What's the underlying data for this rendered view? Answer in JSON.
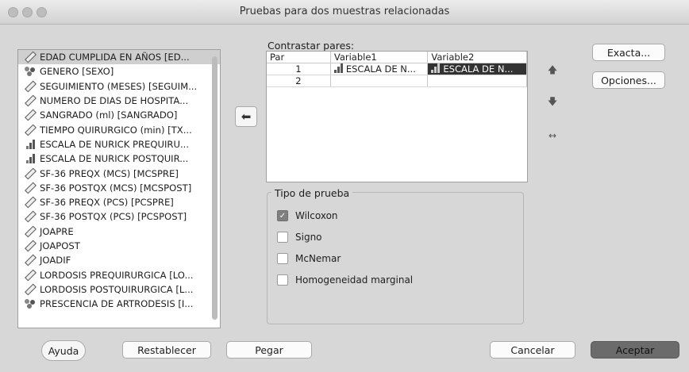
{
  "window": {
    "title": "Pruebas para dos muestras relacionadas"
  },
  "variables": [
    {
      "label": "EDAD CUMPLIDA EN AÑOS [ED...",
      "icon": "ruler-scale-icon",
      "selected": true
    },
    {
      "label": "GENERO [SEXO]",
      "icon": "nominal-icon",
      "selected": false
    },
    {
      "label": "SEGUIMIENTO (MESES) [SEGUIM...",
      "icon": "ruler-scale-icon",
      "selected": false
    },
    {
      "label": "NUMERO DE DIAS DE HOSPITA...",
      "icon": "ruler-scale-icon",
      "selected": false
    },
    {
      "label": "SANGRADO (ml) [SANGRADO]",
      "icon": "ruler-scale-icon",
      "selected": false
    },
    {
      "label": "TIEMPO QUIRURGICO (min) [TX...",
      "icon": "ruler-scale-icon",
      "selected": false
    },
    {
      "label": "ESCALA DE NURICK PREQUIRU...",
      "icon": "ordinal-icon",
      "selected": false
    },
    {
      "label": "ESCALA DE NURICK POSTQUIR...",
      "icon": "ordinal-icon",
      "selected": false
    },
    {
      "label": "SF-36 PREQX (MCS) [MCSPRE]",
      "icon": "ruler-scale-icon",
      "selected": false
    },
    {
      "label": "SF-36 POSTQX (MCS) [MCSPOST]",
      "icon": "ruler-scale-icon",
      "selected": false
    },
    {
      "label": "SF-36 PREQX (PCS) [PCSPRE]",
      "icon": "ruler-scale-icon",
      "selected": false
    },
    {
      "label": "SF-36 POSTQX (PCS) [PCSPOST]",
      "icon": "ruler-scale-icon",
      "selected": false
    },
    {
      "label": "JOAPRE",
      "icon": "ruler-scale-icon",
      "selected": false
    },
    {
      "label": "JOAPOST",
      "icon": "ruler-scale-icon",
      "selected": false
    },
    {
      "label": "JOADIF",
      "icon": "ruler-scale-icon",
      "selected": false
    },
    {
      "label": "LORDOSIS PREQUIRURGICA [LO...",
      "icon": "ruler-scale-icon",
      "selected": false
    },
    {
      "label": "LORDOSIS POSTQUIRURGICA [L...",
      "icon": "ruler-scale-icon",
      "selected": false
    },
    {
      "label": "PRESCENCIA DE ARTRODESIS [I...",
      "icon": "nominal-icon",
      "selected": false
    }
  ],
  "pairs": {
    "title": "Contrastar pares:",
    "columns": [
      "Par",
      "Variable1",
      "Variable2"
    ],
    "rows": [
      {
        "num": "1",
        "var1": "ESCALA DE N...",
        "var2": "ESCALA DE N..."
      },
      {
        "num": "2",
        "var1": "",
        "var2": ""
      }
    ]
  },
  "test_type": {
    "title": "Tipo de prueba",
    "options": [
      {
        "label": "Wilcoxon",
        "checked": true
      },
      {
        "label": "Signo",
        "checked": false
      },
      {
        "label": "McNemar",
        "checked": false
      },
      {
        "label": "Homogeneidad marginal",
        "checked": false
      }
    ]
  },
  "side_buttons": {
    "exact": "Exacta...",
    "options": "Opciones..."
  },
  "footer": {
    "help": "Ayuda",
    "reset": "Restablecer",
    "paste": "Pegar",
    "cancel": "Cancelar",
    "accept": "Aceptar"
  },
  "colors": {
    "dialog_bg": "#d7d7d7",
    "highlight": "#333333",
    "primary_button": "#6b6b6b"
  }
}
